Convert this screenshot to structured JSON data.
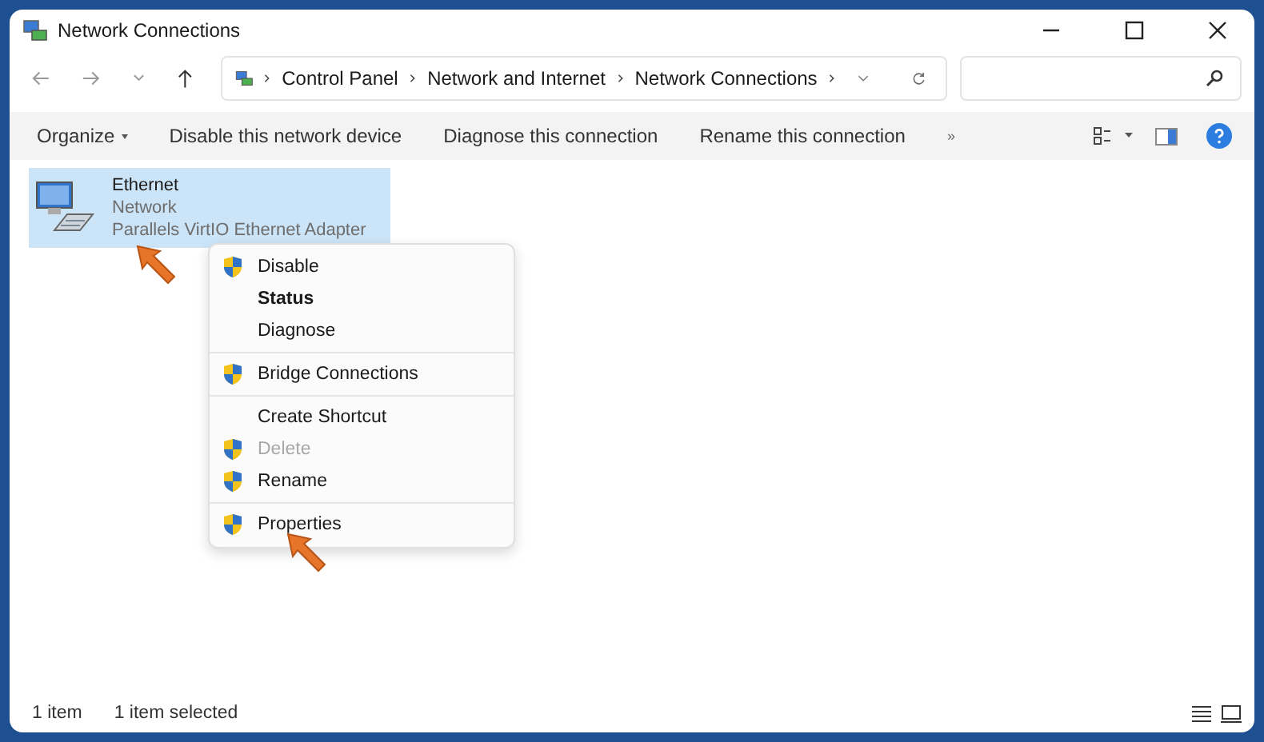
{
  "window": {
    "title": "Network Connections"
  },
  "address": {
    "crumbs": [
      "Control Panel",
      "Network and Internet",
      "Network Connections"
    ]
  },
  "toolbar": [
    {
      "label": "Organize",
      "kind": "dropdown"
    },
    {
      "label": "Disable this network device",
      "kind": "command"
    },
    {
      "label": "Diagnose this connection",
      "kind": "command"
    },
    {
      "label": "Rename this connection",
      "kind": "command"
    },
    {
      "label": "»",
      "kind": "more"
    }
  ],
  "connections": [
    {
      "name": "Ethernet",
      "status": "Network",
      "device": "Parallels VirtIO Ethernet Adapter",
      "selected": true
    }
  ],
  "context_menu": {
    "groups": [
      [
        {
          "label": "Disable",
          "shield": true,
          "bold": false,
          "disabled": false
        },
        {
          "label": "Status",
          "shield": false,
          "bold": true,
          "disabled": false
        },
        {
          "label": "Diagnose",
          "shield": false,
          "bold": false,
          "disabled": false
        }
      ],
      [
        {
          "label": "Bridge Connections",
          "shield": true,
          "bold": false,
          "disabled": false
        }
      ],
      [
        {
          "label": "Create Shortcut",
          "shield": false,
          "bold": false,
          "disabled": false
        },
        {
          "label": "Delete",
          "shield": true,
          "bold": false,
          "disabled": true
        },
        {
          "label": "Rename",
          "shield": true,
          "bold": false,
          "disabled": false
        }
      ],
      [
        {
          "label": "Properties",
          "shield": true,
          "bold": false,
          "disabled": false
        }
      ]
    ]
  },
  "status_bar": {
    "count": "1 item",
    "selection": "1 item selected"
  }
}
